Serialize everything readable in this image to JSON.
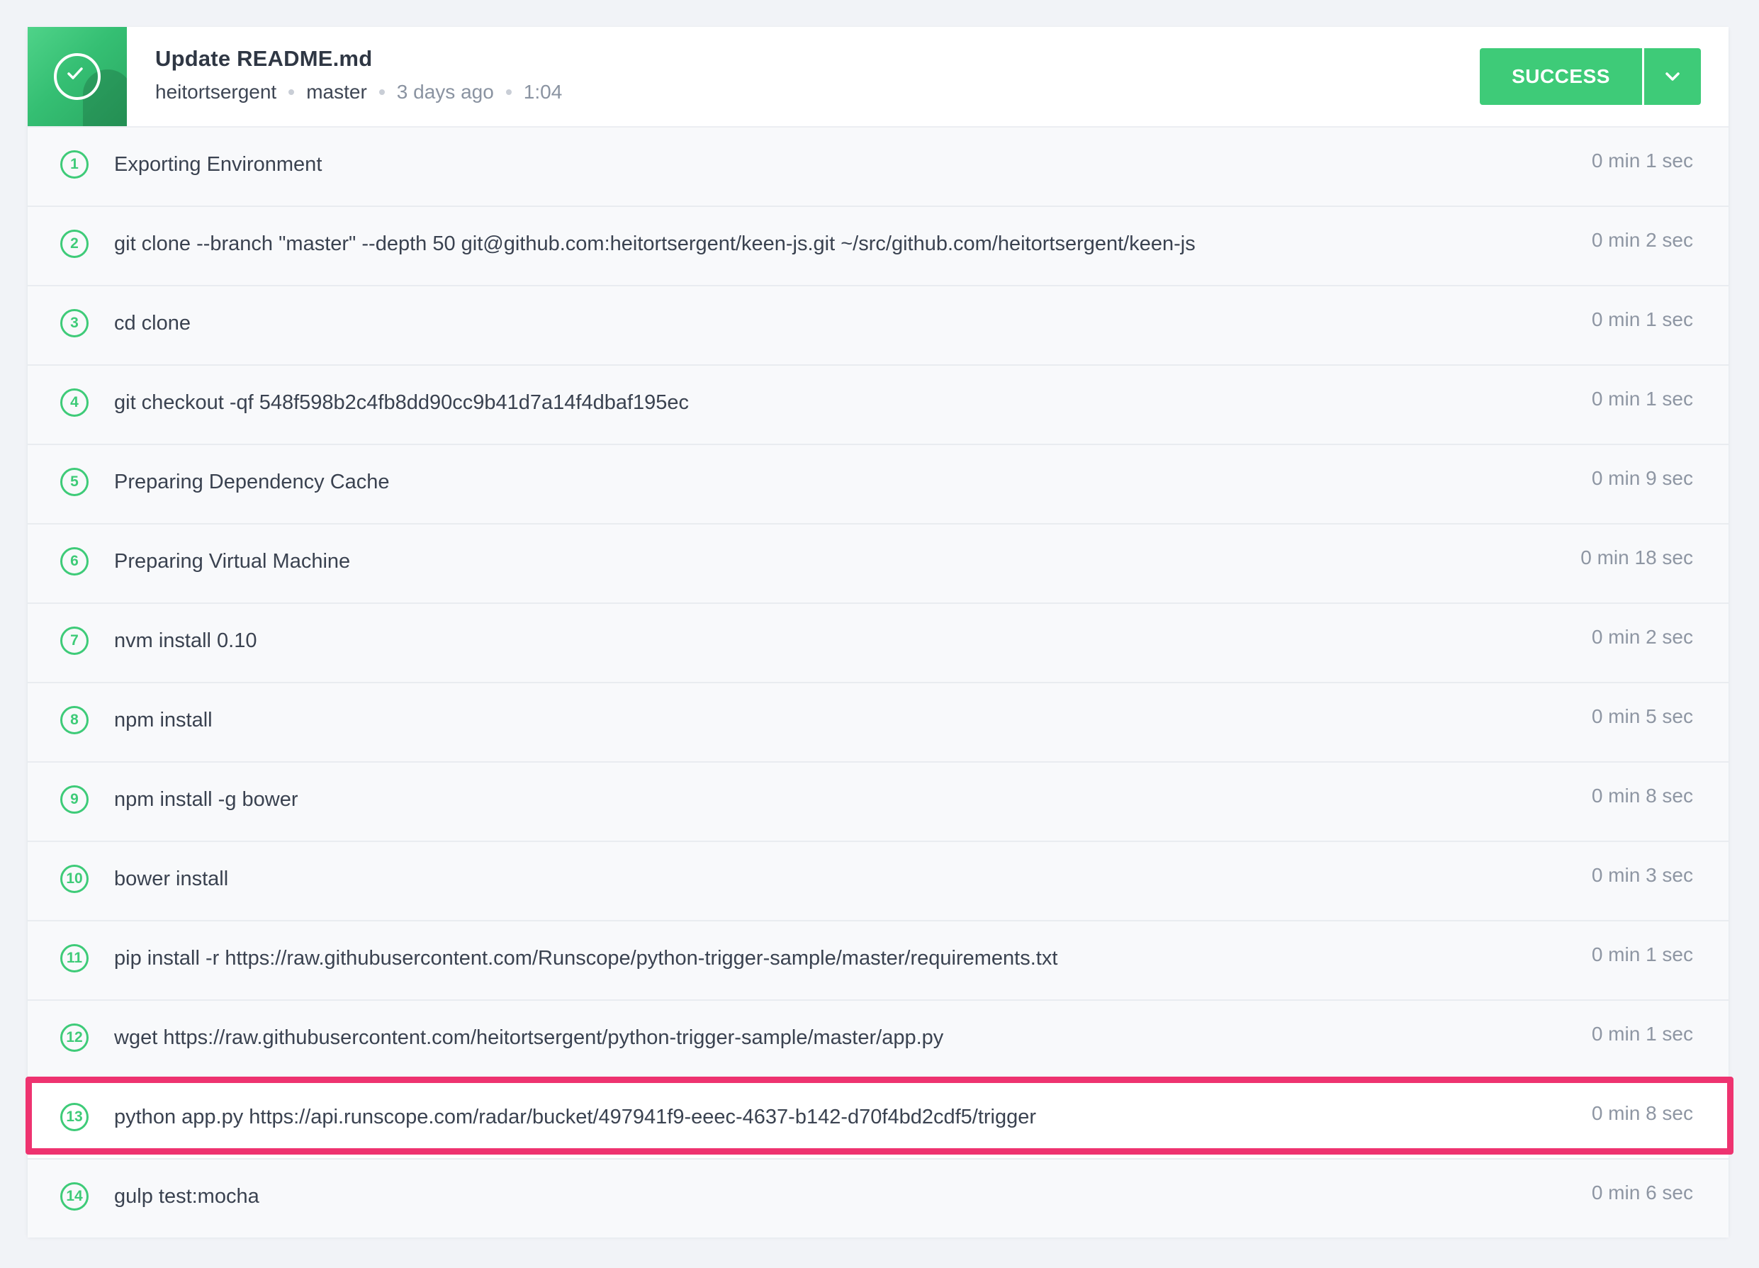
{
  "build": {
    "title": "Update README.md",
    "author": "heitortsergent",
    "branch": "master",
    "time_ago": "3 days ago",
    "duration": "1:04",
    "status_label": "SUCCESS"
  },
  "colors": {
    "success": "#3ecb78",
    "highlight_border": "#ee3370"
  },
  "icons": {
    "avatar_status": "check-circle-icon",
    "status_toggle": "chevron-down-icon"
  },
  "steps": [
    {
      "num": "1",
      "command": "Exporting Environment",
      "duration": "0 min 1 sec"
    },
    {
      "num": "2",
      "command": "git clone --branch \"master\" --depth 50 git@github.com:heitortsergent/keen-js.git ~/src/github.com/heitortsergent/keen-js",
      "duration": "0 min 2 sec"
    },
    {
      "num": "3",
      "command": "cd clone",
      "duration": "0 min 1 sec"
    },
    {
      "num": "4",
      "command": "git checkout -qf 548f598b2c4fb8dd90cc9b41d7a14f4dbaf195ec",
      "duration": "0 min 1 sec"
    },
    {
      "num": "5",
      "command": "Preparing Dependency Cache",
      "duration": "0 min 9 sec"
    },
    {
      "num": "6",
      "command": "Preparing Virtual Machine",
      "duration": "0 min 18 sec"
    },
    {
      "num": "7",
      "command": "nvm install 0.10",
      "duration": "0 min 2 sec"
    },
    {
      "num": "8",
      "command": "npm install",
      "duration": "0 min 5 sec"
    },
    {
      "num": "9",
      "command": "npm install -g bower",
      "duration": "0 min 8 sec"
    },
    {
      "num": "10",
      "command": "bower install",
      "duration": "0 min 3 sec"
    },
    {
      "num": "11",
      "command": "pip install -r https://raw.githubusercontent.com/Runscope/python-trigger-sample/master/requirements.txt",
      "duration": "0 min 1 sec"
    },
    {
      "num": "12",
      "command": "wget https://raw.githubusercontent.com/heitortsergent/python-trigger-sample/master/app.py",
      "duration": "0 min 1 sec"
    },
    {
      "num": "13",
      "command": "python app.py https://api.runscope.com/radar/bucket/497941f9-eeec-4637-b142-d70f4bd2cdf5/trigger",
      "duration": "0 min 8 sec"
    },
    {
      "num": "14",
      "command": "gulp test:mocha",
      "duration": "0 min 6 sec"
    }
  ]
}
